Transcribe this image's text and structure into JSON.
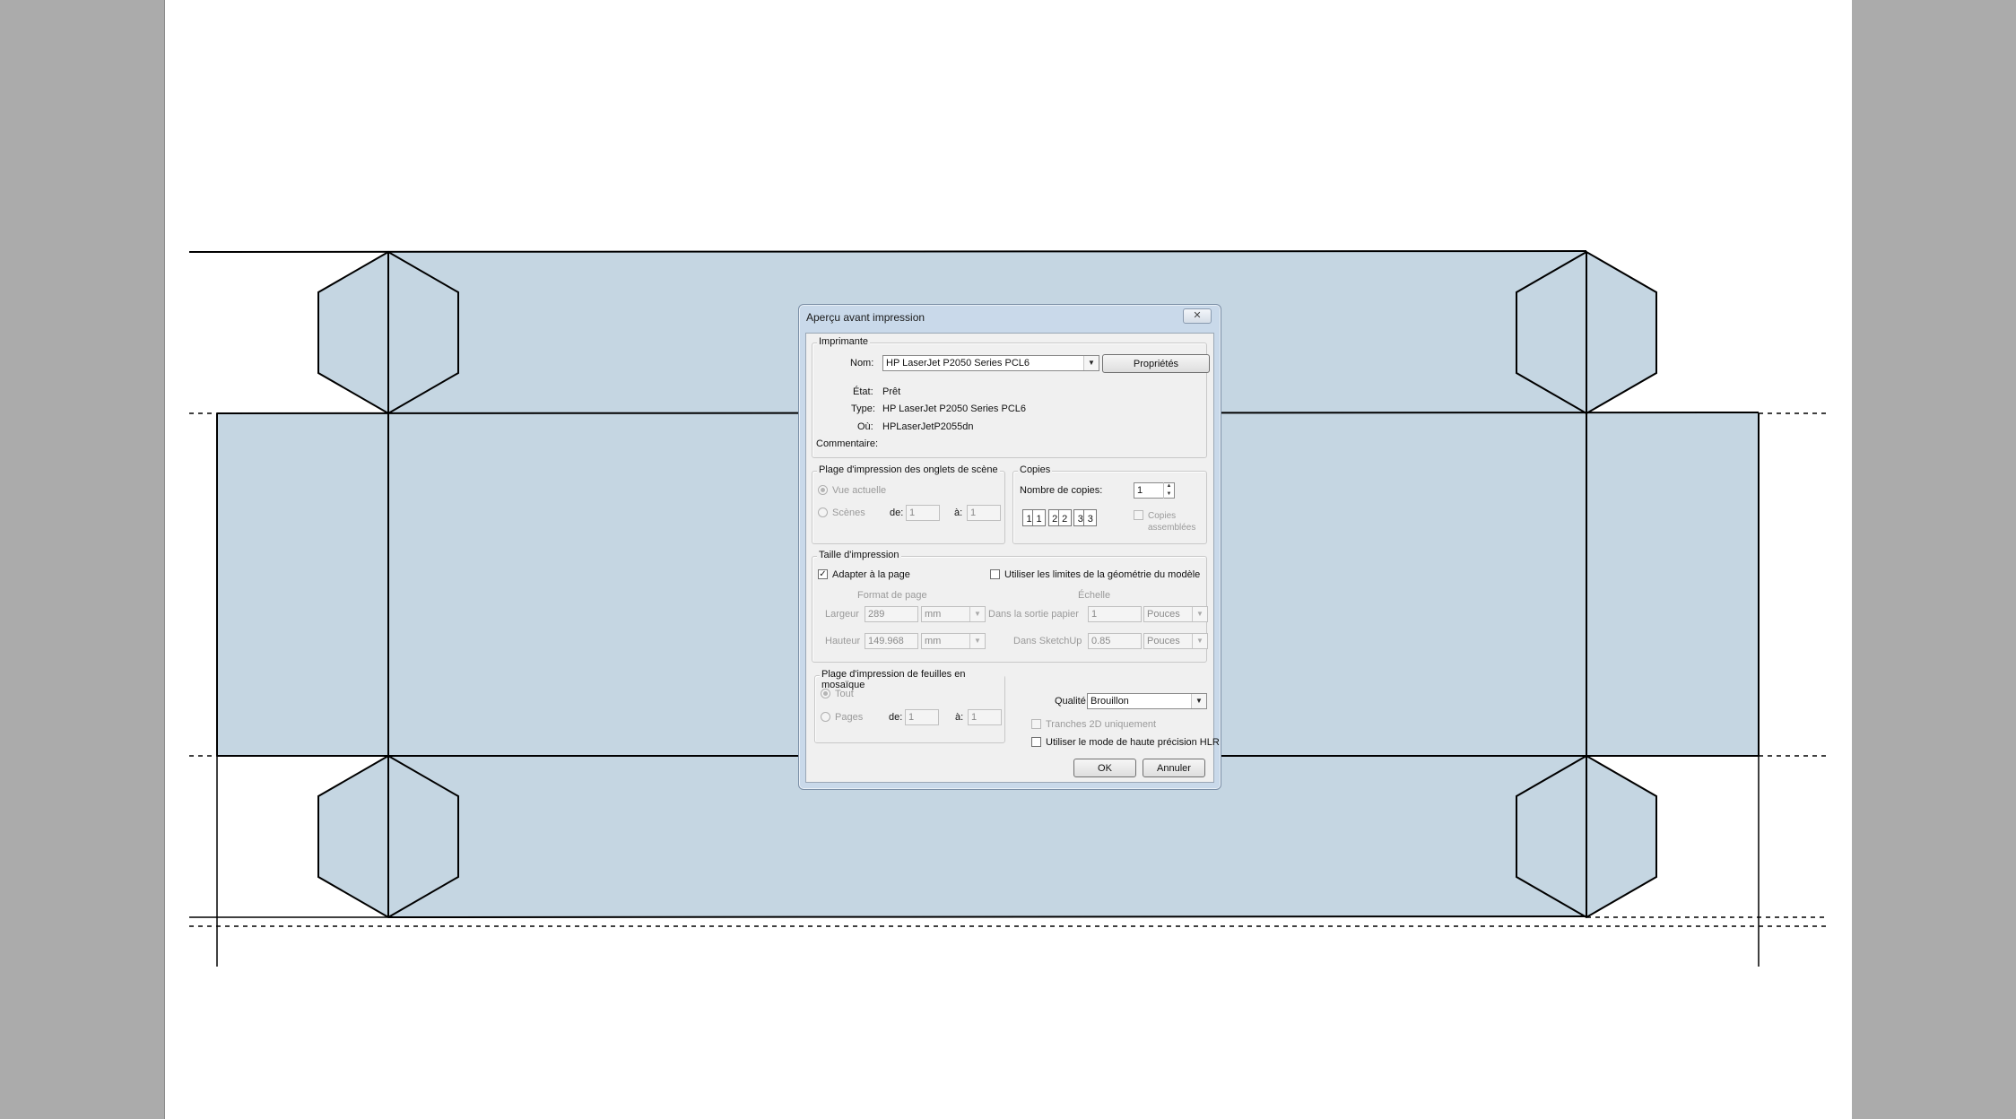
{
  "dialog": {
    "title": "Aperçu avant impression",
    "close_label": "✕",
    "printer": {
      "group_label": "Imprimante",
      "name_label": "Nom:",
      "name_value": "HP LaserJet P2050 Series PCL6",
      "properties_button": "Propriétés",
      "status_label": "État:",
      "status_value": "Prêt",
      "type_label": "Type:",
      "type_value": "HP LaserJet P2050 Series PCL6",
      "where_label": "Où:",
      "where_value": "HPLaserJetP2055dn",
      "comment_label": "Commentaire:"
    },
    "scene_range": {
      "group_label": "Plage d'impression des onglets de scène",
      "current_view": "Vue actuelle",
      "scenes": "Scènes",
      "from_label": "de:",
      "from_value": "1",
      "to_label": "à:",
      "to_value": "1"
    },
    "copies": {
      "group_label": "Copies",
      "count_label": "Nombre de copies:",
      "count_value": "1",
      "collate_label_1": "Copies",
      "collate_label_2": "assemblées",
      "page_digits": [
        "1",
        "1",
        "2",
        "2",
        "3",
        "3"
      ]
    },
    "print_size": {
      "group_label": "Taille d'impression",
      "fit_page": "Adapter à la page",
      "use_limits": "Utiliser les limites de la géométrie du modèle",
      "page_format_header": "Format de page",
      "scale_header": "Échelle",
      "width_label": "Largeur",
      "width_value": "289",
      "width_unit": "mm",
      "height_label": "Hauteur",
      "height_value": "149.968",
      "height_unit": "mm",
      "paper_out_label": "Dans la sortie papier",
      "paper_out_value": "1",
      "paper_out_unit": "Pouces",
      "sketchup_label": "Dans SketchUp",
      "sketchup_value": "0.85",
      "sketchup_unit": "Pouces"
    },
    "tile_range": {
      "group_label": "Plage d'impression de feuilles en mosaïque",
      "all": "Tout",
      "pages": "Pages",
      "from_label": "de:",
      "from_value": "1",
      "to_label": "à:",
      "to_value": "1"
    },
    "quality": {
      "label": "Qualité",
      "value": "Brouillon",
      "slices_2d": "Tranches 2D uniquement",
      "hlr_mode": "Utiliser le mode de haute précision HLR"
    },
    "ok_button": "OK",
    "cancel_button": "Annuler"
  },
  "colors": {
    "background": "#ababab",
    "page": "#ffffff",
    "box_fill": "#c5d6e2",
    "dialog_frame": "#c9d9ea",
    "dialog_body": "#f0f0f0"
  }
}
